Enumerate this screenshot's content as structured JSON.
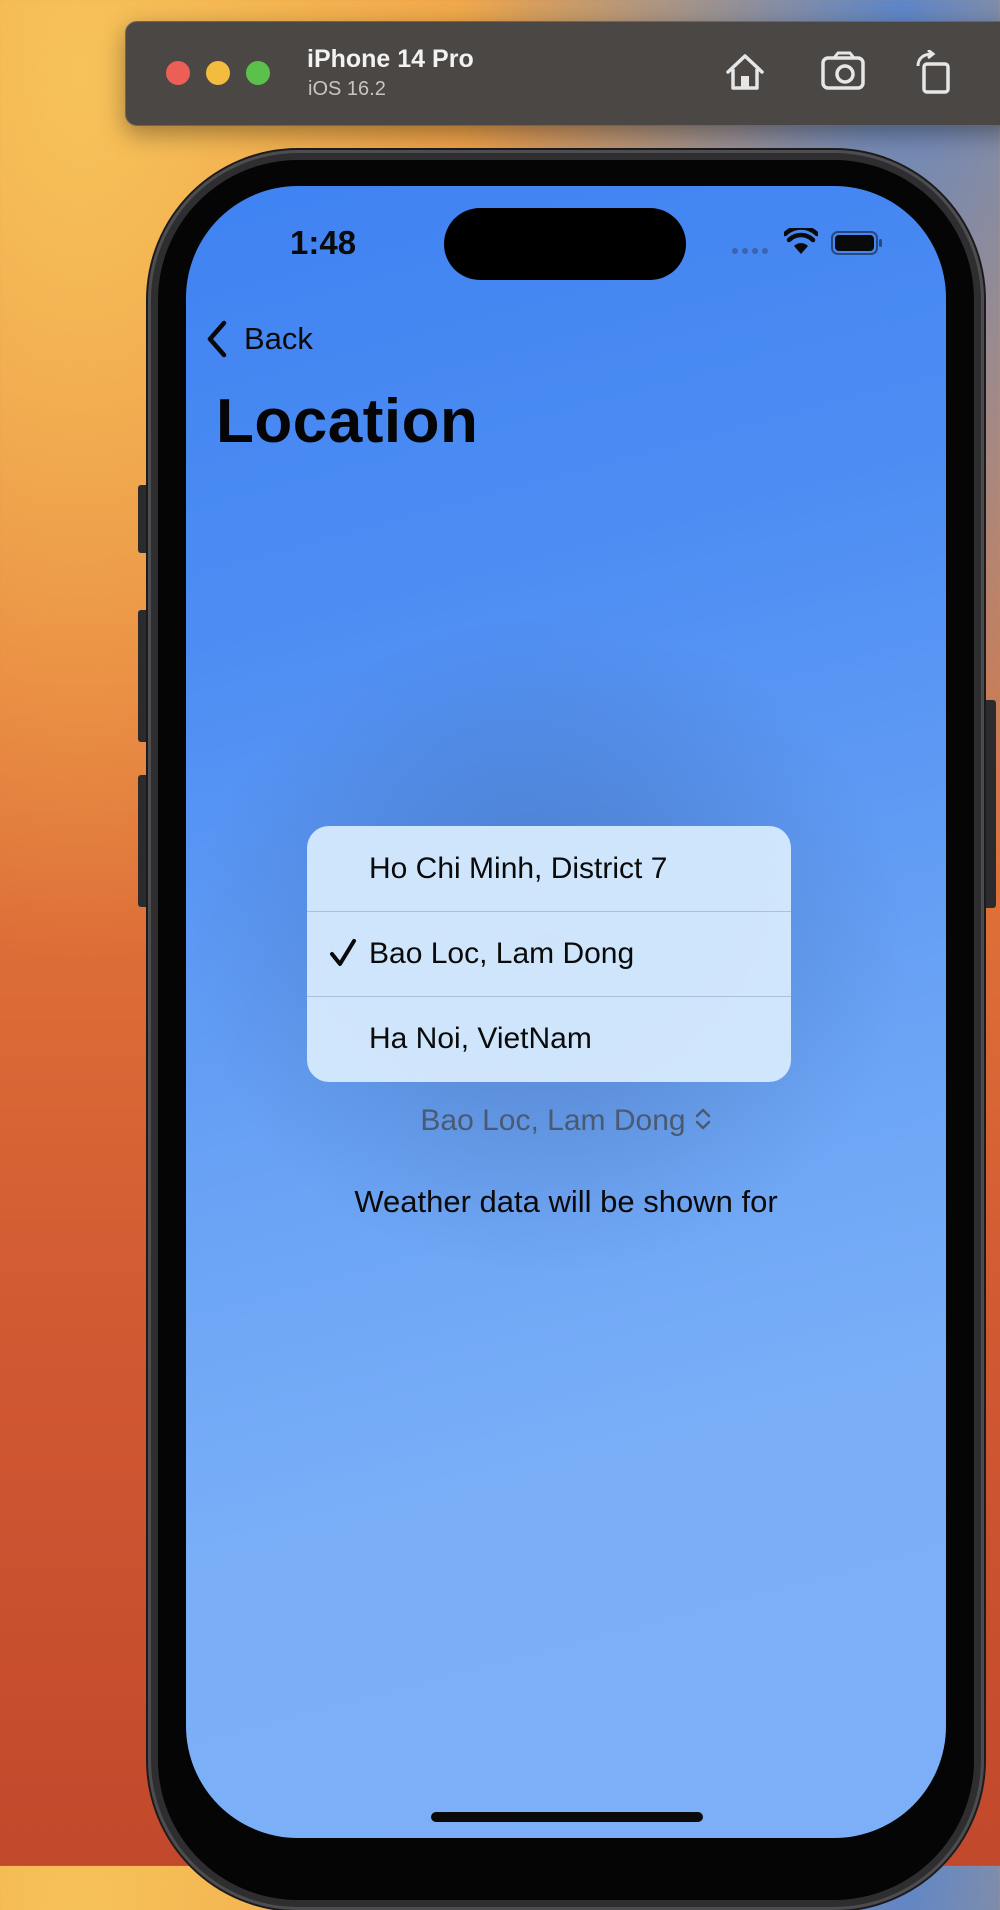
{
  "toolbar": {
    "device_name": "iPhone 14 Pro",
    "os_version": "iOS 16.2",
    "icons": [
      "home-icon",
      "screenshot-icon",
      "rotate-icon"
    ]
  },
  "status_bar": {
    "time": "1:48",
    "icons": [
      "cellular-icon",
      "wifi-icon",
      "battery-icon"
    ]
  },
  "nav": {
    "back_label": "Back",
    "title": "Location"
  },
  "menu": {
    "items": [
      {
        "label": "Ho Chi Minh, District 7",
        "selected": false
      },
      {
        "label": "Bao Loc, Lam Dong",
        "selected": true
      },
      {
        "label": "Ha Noi, VietNam",
        "selected": false
      }
    ]
  },
  "picker": {
    "selected_value": "Bao Loc, Lam Dong"
  },
  "caption": "Weather data will be shown for",
  "colors": {
    "screen_top": "#3f82f2",
    "screen_bottom": "#7caff8",
    "menu_bg": "#d6eafd"
  }
}
